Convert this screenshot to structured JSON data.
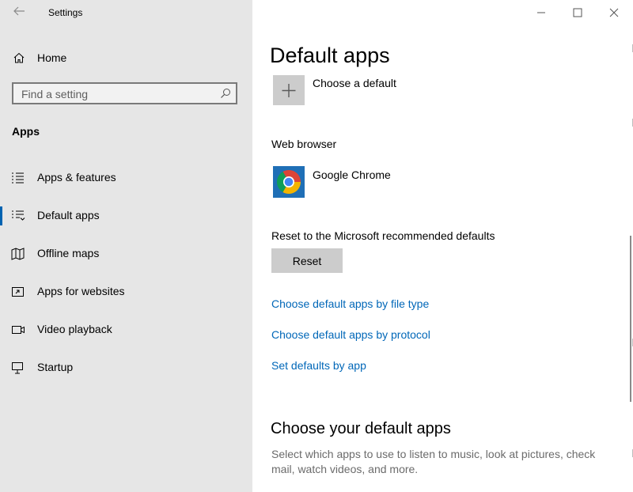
{
  "window": {
    "app_title": "Settings",
    "minimize_icon": "minimize-icon",
    "maximize_icon": "maximize-icon",
    "close_icon": "close-icon"
  },
  "sidebar": {
    "back_icon": "back-arrow-icon",
    "home_label": "Home",
    "search": {
      "placeholder": "Find a setting",
      "value": "",
      "icon": "search-icon"
    },
    "section_title": "Apps",
    "items": [
      {
        "label": "Apps & features",
        "icon": "list-icon",
        "selected": false
      },
      {
        "label": "Default apps",
        "icon": "default-list-icon",
        "selected": true
      },
      {
        "label": "Offline maps",
        "icon": "map-icon",
        "selected": false
      },
      {
        "label": "Apps for websites",
        "icon": "web-app-icon",
        "selected": false
      },
      {
        "label": "Video playback",
        "icon": "video-icon",
        "selected": false
      },
      {
        "label": "Startup",
        "icon": "startup-icon",
        "selected": false
      }
    ],
    "accent_color": "#0063b1"
  },
  "main": {
    "title": "Default apps",
    "choose_default_label": "Choose a default",
    "web_browser_heading": "Web browser",
    "web_browser_app": "Google Chrome",
    "reset_heading": "Reset to the Microsoft recommended defaults",
    "reset_button": "Reset",
    "links": [
      "Choose default apps by file type",
      "Choose default apps by protocol",
      "Set defaults by app"
    ],
    "choose_section_title": "Choose your default apps",
    "choose_section_desc": "Select which apps to use to listen to music, look at pictures, check mail, watch videos, and more.",
    "link_color": "#0067b8"
  }
}
